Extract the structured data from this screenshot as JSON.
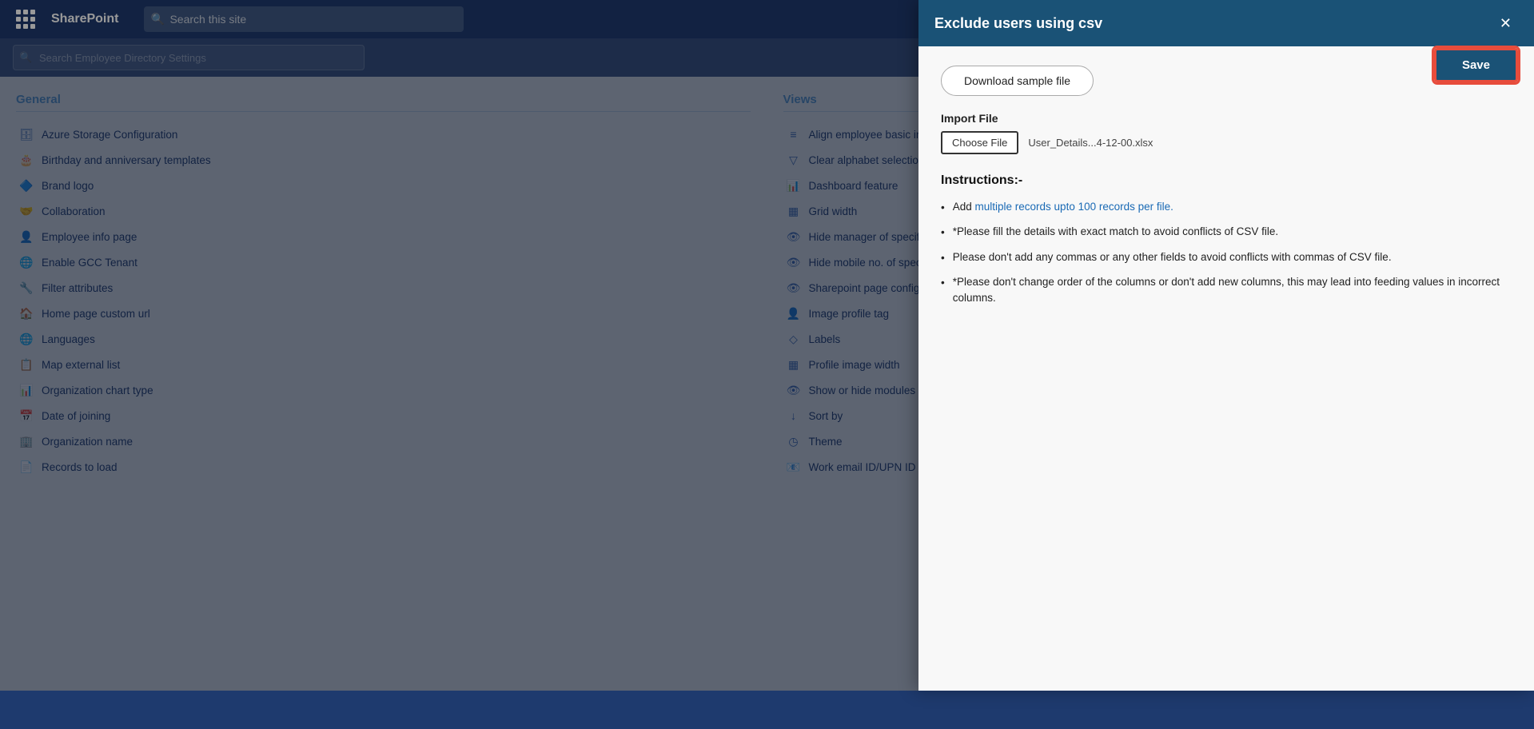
{
  "topbar": {
    "brand": "SharePoint",
    "search_placeholder": "Search this site"
  },
  "settings_search": {
    "placeholder": "Search Employee Directory Settings"
  },
  "general_column": {
    "title": "General",
    "items": [
      {
        "label": "Azure Storage Configuration",
        "icon": "🗄"
      },
      {
        "label": "Birthday and anniversary templates",
        "icon": "🎂"
      },
      {
        "label": "Brand logo",
        "icon": "🔷"
      },
      {
        "label": "Collaboration",
        "icon": "🤝"
      },
      {
        "label": "Employee info page",
        "icon": "👤"
      },
      {
        "label": "Enable GCC Tenant",
        "icon": "🌐"
      },
      {
        "label": "Filter attributes",
        "icon": "🔧"
      },
      {
        "label": "Home page custom url",
        "icon": "🏠"
      },
      {
        "label": "Languages",
        "icon": "🌐"
      },
      {
        "label": "Map external list",
        "icon": "📋"
      },
      {
        "label": "Organization chart type",
        "icon": "📊"
      },
      {
        "label": "Date of joining",
        "icon": "📅"
      },
      {
        "label": "Organization name",
        "icon": "🏢"
      },
      {
        "label": "Records to load",
        "icon": "📄"
      }
    ]
  },
  "views_column": {
    "title": "Views",
    "items": [
      {
        "label": "Align employee basic information",
        "icon": "≡"
      },
      {
        "label": "Clear alphabet selection with reset filter",
        "icon": "▽"
      },
      {
        "label": "Dashboard feature",
        "icon": "📊"
      },
      {
        "label": "Grid width",
        "icon": "▦"
      },
      {
        "label": "Hide manager of specific users",
        "icon": "👁"
      },
      {
        "label": "Hide mobile no. of specific users",
        "icon": "👁"
      },
      {
        "label": "Sharepoint page configuration",
        "icon": "👁"
      },
      {
        "label": "Image profile tag",
        "icon": "👤"
      },
      {
        "label": "Labels",
        "icon": "◇"
      },
      {
        "label": "Profile image width",
        "icon": "▦"
      },
      {
        "label": "Show or hide modules",
        "icon": "👁"
      },
      {
        "label": "Sort by",
        "icon": "↓"
      },
      {
        "label": "Theme",
        "icon": "◷"
      },
      {
        "label": "Work email ID/UPN ID",
        "icon": "📧"
      }
    ]
  },
  "modal": {
    "title": "Exclude users using csv",
    "close_label": "✕",
    "download_btn": "Download sample file",
    "import_label": "Import File",
    "choose_file_btn": "Choose File",
    "file_name": "User_Details...4-12-00.xlsx",
    "instructions_title": "Instructions:-",
    "instructions": [
      {
        "text": "Add ",
        "highlight": "multiple records upto 100 records per file.",
        "rest": ""
      },
      {
        "text": "*Please fill the details with exact match to avoid conflicts of CSV file.",
        "highlight": "",
        "rest": ""
      },
      {
        "text": "Please don't add any commas or any other fields to avoid conflicts with commas of CSV file.",
        "highlight": "",
        "rest": ""
      },
      {
        "text": "*Please don't change order of the columns or don't add new columns, this may lead into feeding values in incorrect columns.",
        "highlight": "",
        "rest": ""
      }
    ],
    "save_btn": "Save"
  }
}
